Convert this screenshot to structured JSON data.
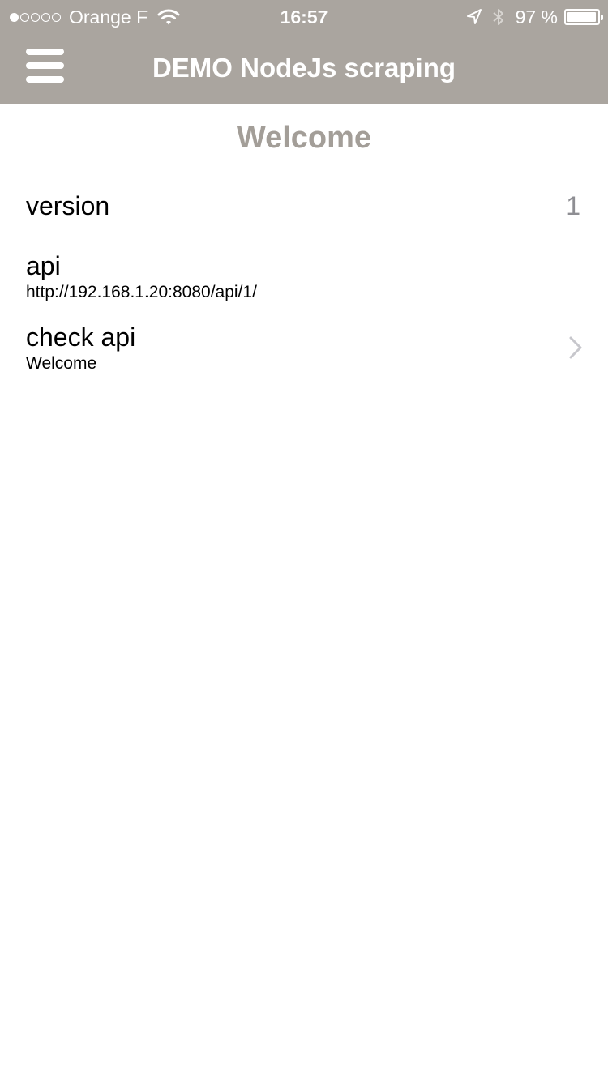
{
  "status_bar": {
    "carrier": "Orange F",
    "signal_bars_filled": 1,
    "signal_bars_total": 5,
    "time": "16:57",
    "battery_percent": "97 %",
    "battery_level": 0.97,
    "icons": [
      "wifi-icon",
      "location-icon",
      "bluetooth-icon",
      "battery-icon"
    ]
  },
  "nav": {
    "title": "DEMO NodeJs scraping",
    "menu_icon": "hamburger-menu-icon"
  },
  "colors": {
    "header_bg": "#aaa59f",
    "page_title": "#a39e98",
    "value_text": "#8e8e93",
    "chevron": "#c7c7cc"
  },
  "page": {
    "title": "Welcome"
  },
  "list": {
    "items": [
      {
        "label": "version",
        "value": "1"
      },
      {
        "label": "api",
        "subtitle": "http://192.168.1.20:8080/api/1/"
      },
      {
        "label": "check api",
        "subtitle": "Welcome",
        "accessory": "chevron-right-icon"
      }
    ]
  }
}
